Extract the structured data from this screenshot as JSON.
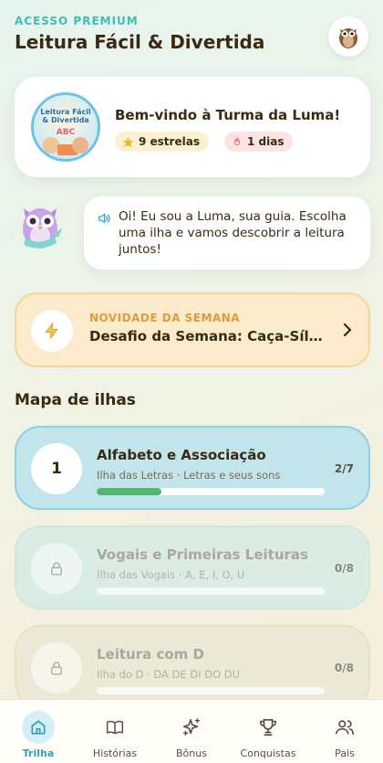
{
  "header": {
    "premium_label": "ACESSO PREMIUM",
    "title": "Leitura Fácil & Divertida",
    "avatar_icon": "owl-icon"
  },
  "welcome": {
    "logo_line1": "Leitura Fácil",
    "logo_line2": "& Divertida",
    "logo_abc": "ABC",
    "title": "Bem-vindo à Turma da Luma!",
    "stars": "9 estrelas",
    "days": "1 dias"
  },
  "guide": {
    "message": "Oi! Eu sou a Luma, sua guia. Escolha uma ilha e vamos descobrir a leitura juntos!"
  },
  "novelty": {
    "label": "NOVIDADE DA SEMANA",
    "title": "Desafio da Semana: Caça-Sílab..."
  },
  "map": {
    "title": "Mapa de ilhas",
    "islands": [
      {
        "number": "1",
        "title": "Alfabeto e Associação",
        "subtitle": "Ilha das Letras · Letras e seus sons",
        "count": "2/7",
        "progress": 0.2857,
        "locked": false
      },
      {
        "number": "",
        "title": "Vogais e Primeiras Leituras",
        "subtitle": "Ilha das Vogais · A, E, I, O, U",
        "count": "0/8",
        "progress": 0,
        "locked": true
      },
      {
        "number": "",
        "title": "Leitura com D",
        "subtitle": "Ilha do D · DA DE DI DO DU",
        "count": "0/8",
        "progress": 0,
        "locked": true
      }
    ]
  },
  "nav": {
    "items": [
      {
        "label": "Trilha",
        "icon": "home-icon",
        "active": true
      },
      {
        "label": "Histórias",
        "icon": "book-icon",
        "active": false
      },
      {
        "label": "Bônus",
        "icon": "sparkle-icon",
        "active": false
      },
      {
        "label": "Conquistas",
        "icon": "trophy-icon",
        "active": false
      },
      {
        "label": "Pais",
        "icon": "users-icon",
        "active": false
      }
    ]
  },
  "colors": {
    "accent": "#2f9fc2",
    "premium": "#3fbfb0",
    "progress": "#54b574",
    "novelty": "#e59a3a"
  }
}
